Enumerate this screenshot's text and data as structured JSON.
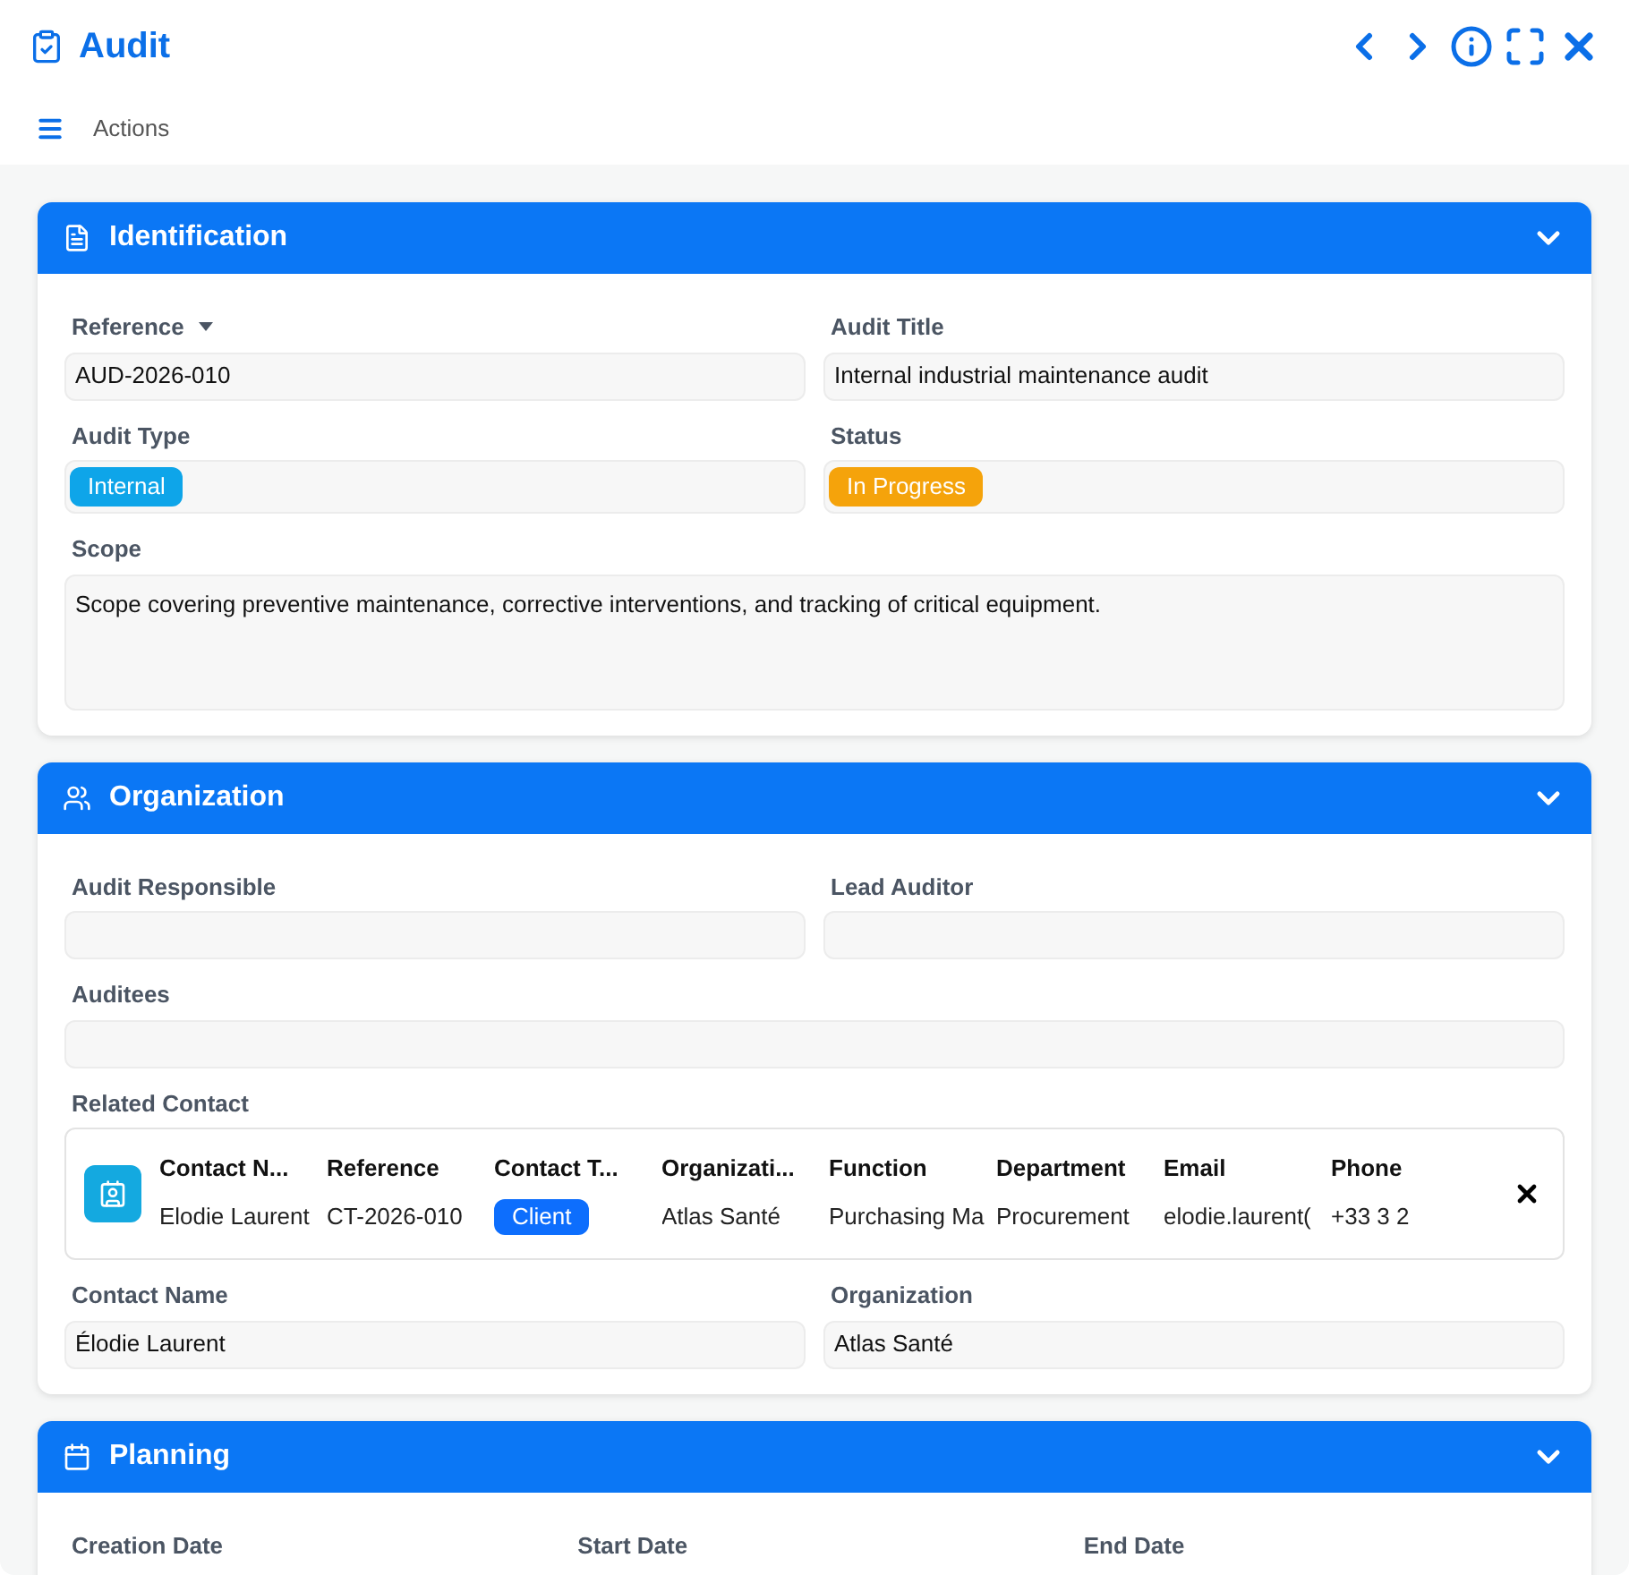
{
  "window": {
    "title": "Audit"
  },
  "actions": {
    "label": "Actions"
  },
  "sections": [
    {
      "title": "Identification",
      "expanded": true,
      "rows": [
        {
          "fields": [
            {
              "kind": "text",
              "label": "Reference",
              "value": "AUD-2026-010"
            },
            {
              "kind": "text",
              "label": "Audit Title",
              "value": "Internal industrial maintenance audit"
            }
          ]
        },
        {
          "fields": [
            {
              "kind": "badge",
              "label": "Audit Type",
              "value": "Internal",
              "color": "#0ea5e9"
            },
            {
              "kind": "badge",
              "label": "Status",
              "value": "In Progress",
              "color": "#f5a30b"
            }
          ]
        },
        {
          "fields": [
            {
              "kind": "textarea",
              "label": "Scope",
              "value": "Scope covering preventive maintenance, corrective interventions, and tracking of critical equipment."
            }
          ]
        }
      ]
    },
    {
      "title": "Organization",
      "expanded": true,
      "rows": [
        {
          "fields": [
            {
              "kind": "text",
              "label": "Audit Responsible"
            },
            {
              "kind": "text",
              "label": "Lead Auditor"
            }
          ]
        },
        {
          "fields": [
            {
              "kind": "text",
              "label": "Auditees"
            }
          ]
        },
        {
          "fields": [
            {
              "kind": "table",
              "label": "Related Contact",
              "columns": [
                "Contact N...",
                "Reference",
                "Contact T...",
                "Organizati...",
                "Function",
                "Department",
                "Email",
                "Phone"
              ],
              "row": [
                {
                  "kind": "text",
                  "value": "Elodie Laurent"
                },
                {
                  "kind": "text",
                  "value": "CT-2026-010"
                },
                {
                  "kind": "badge",
                  "value": "Client",
                  "color": "#0d6efd"
                },
                {
                  "kind": "text",
                  "value": "Atlas Santé"
                },
                {
                  "kind": "text",
                  "value": "Purchasing Ma"
                },
                {
                  "kind": "text",
                  "value": "Procurement"
                },
                {
                  "kind": "text",
                  "value": "elodie.laurent("
                },
                {
                  "kind": "text",
                  "value": "+33 3 2"
                }
              ]
            }
          ]
        },
        {
          "fields": [
            {
              "kind": "text",
              "label": "Contact Name",
              "value": "Élodie Laurent"
            },
            {
              "kind": "text",
              "label": "Organization",
              "value": "Atlas Santé"
            }
          ]
        }
      ]
    },
    {
      "title": "Planning",
      "expanded": true,
      "rows": [
        {
          "fields": [
            {
              "kind": "label",
              "label": "Creation Date"
            },
            {
              "kind": "label",
              "label": "Start Date"
            },
            {
              "kind": "label",
              "label": "End Date"
            }
          ]
        }
      ]
    }
  ]
}
